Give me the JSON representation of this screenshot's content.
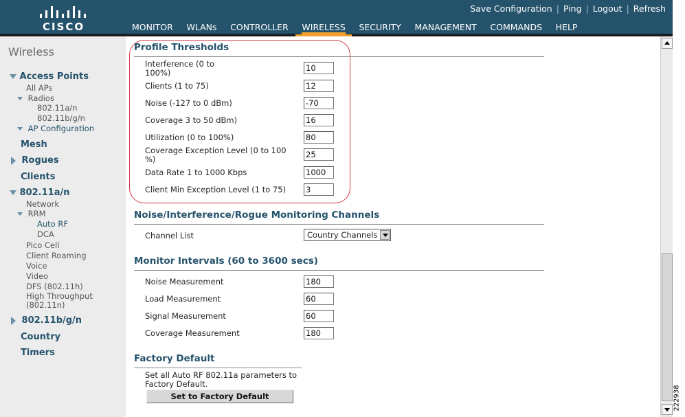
{
  "header": {
    "logo_text": "CISCO",
    "top_links": [
      "Save Configuration",
      "Ping",
      "Logout",
      "Refresh"
    ],
    "nav": [
      "MONITOR",
      "WLANs",
      "CONTROLLER",
      "WIRELESS",
      "SECURITY",
      "MANAGEMENT",
      "COMMANDS",
      "HELP"
    ],
    "active_nav": "WIRELESS",
    "colors": {
      "bar": "#25536c",
      "accent": "#f0a030"
    }
  },
  "sidebar": {
    "title": "Wireless",
    "access_points": "Access Points",
    "all_aps": "All APs",
    "radios": "Radios",
    "radio_a": "802.11a/n",
    "radio_bg": "802.11b/g/n",
    "ap_configuration": "AP Configuration",
    "mesh": "Mesh",
    "rogues": "Rogues",
    "clients": "Clients",
    "dot11a": "802.11a/n",
    "network": "Network",
    "rrm": "RRM",
    "auto_rf": "Auto RF",
    "dca": "DCA",
    "pico_cell": "Pico Cell",
    "client_roaming": "Client Roaming",
    "voice": "Voice",
    "video": "Video",
    "dfs": "DFS (802.11h)",
    "high_throughput_1": "High Throughput",
    "high_throughput_2": "(802.11n)",
    "dot11bg": "802.11b/g/n",
    "country": "Country",
    "timers": "Timers"
  },
  "profile_thresholds": {
    "title": "Profile Thresholds",
    "rows": [
      {
        "label_1": "Interference (0 to",
        "label_2": "100%)",
        "value": "10"
      },
      {
        "label_1": "Clients (1 to 75)",
        "label_2": "",
        "value": "12"
      },
      {
        "label_1": "Noise (-127 to 0 dBm)",
        "label_2": "",
        "value": "-70"
      },
      {
        "label_1": "Coverage 3 to 50 dBm)",
        "label_2": "",
        "value": "16"
      },
      {
        "label_1": "Utilization (0 to 100%)",
        "label_2": "",
        "value": "80"
      },
      {
        "label_1": "Coverage Exception Level (0 to 100",
        "label_2": "%)",
        "value": "25"
      },
      {
        "label_1": "Data Rate 1 to 1000 Kbps",
        "label_2": "",
        "value": "1000"
      },
      {
        "label_1": "Client Min Exception Level (1 to 75)",
        "label_2": "",
        "value": "3"
      }
    ]
  },
  "monitoring_channels": {
    "title": "Noise/Interference/Rogue Monitoring Channels",
    "channel_list_label": "Channel List",
    "channel_list_value": "Country Channels"
  },
  "monitor_intervals": {
    "title": "Monitor Intervals (60 to 3600 secs)",
    "rows": [
      {
        "label": "Noise Measurement",
        "value": "180"
      },
      {
        "label": "Load Measurement",
        "value": "60"
      },
      {
        "label": "Signal Measurement",
        "value": "60"
      },
      {
        "label": "Coverage Measurement",
        "value": "180"
      }
    ]
  },
  "factory_default": {
    "title": "Factory Default",
    "description_1": "Set all Auto RF 802.11a parameters to",
    "description_2": "Factory Default.",
    "button": "Set to Factory Default"
  },
  "figure_id": "222938"
}
